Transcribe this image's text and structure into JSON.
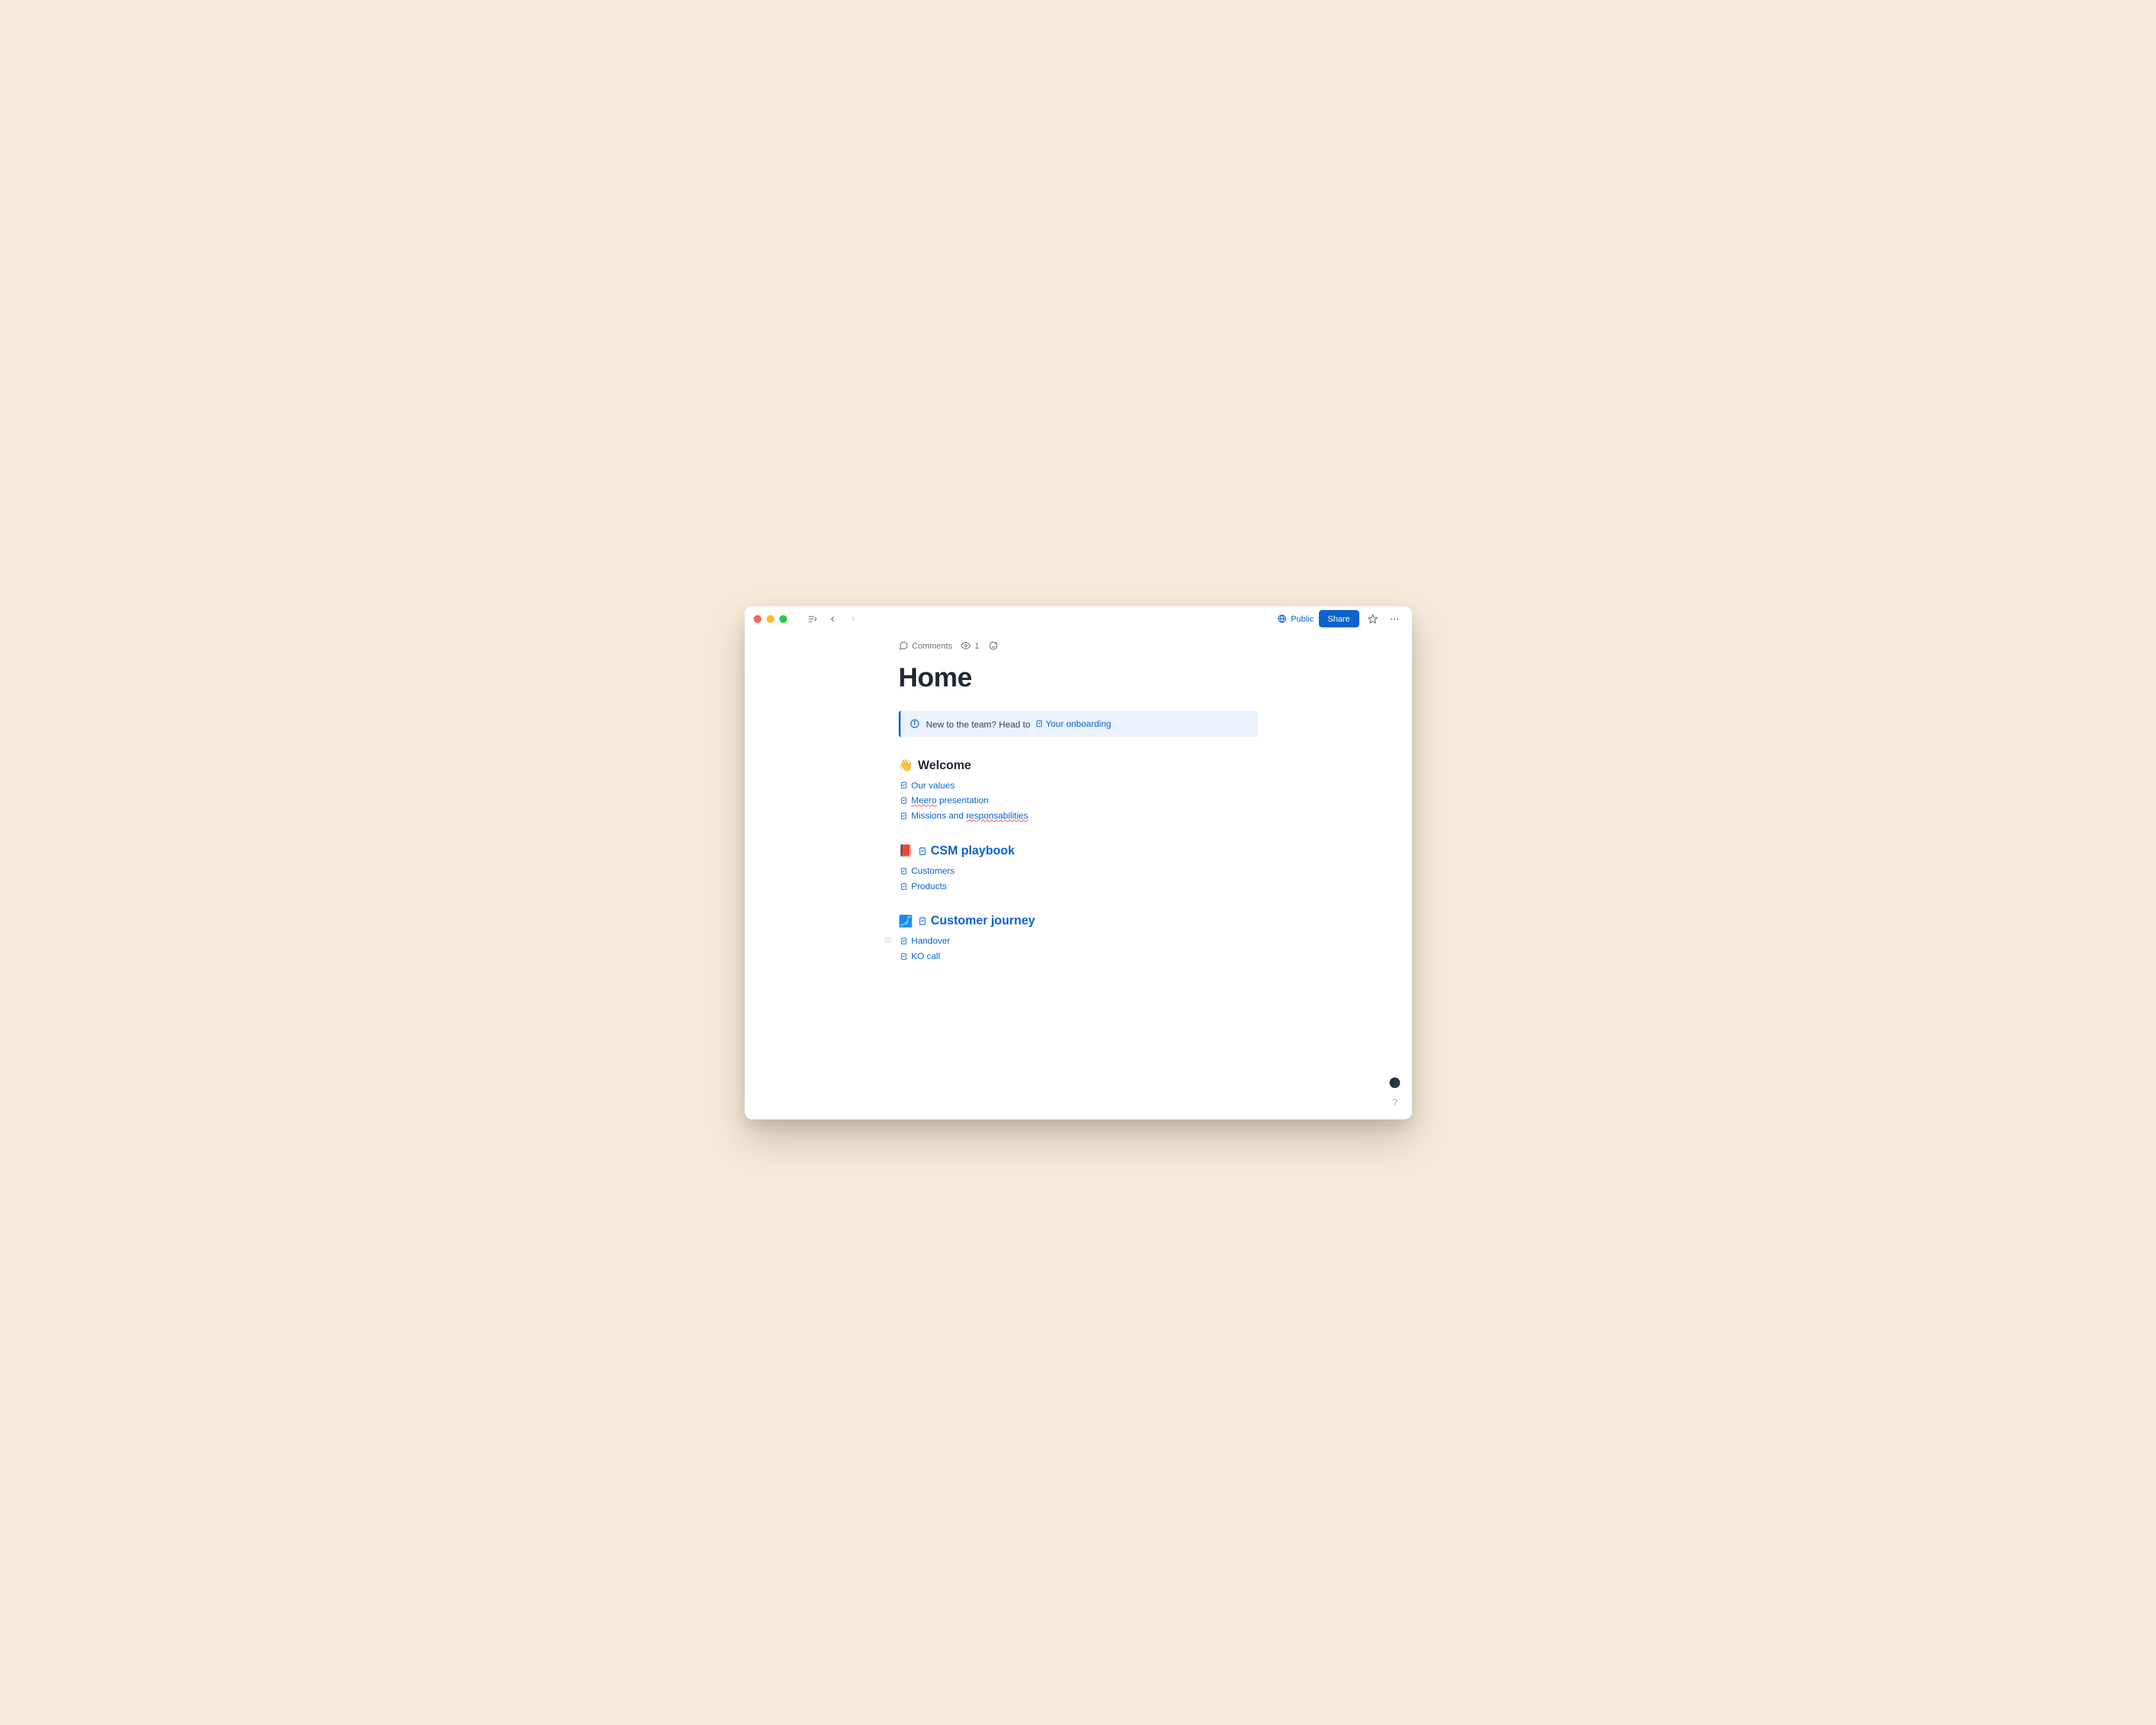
{
  "toolbar": {
    "public_label": "Public",
    "share_label": "Share"
  },
  "meta": {
    "comments_label": "Comments",
    "view_count": "1"
  },
  "page": {
    "title": "Home"
  },
  "callout": {
    "text": "New to the team? Head to",
    "link_label": "Your onboarding"
  },
  "sections": {
    "welcome": {
      "emoji": "👋",
      "heading": "Welcome",
      "links": {
        "values": "Our values",
        "meero_pre": "Meero",
        "meero_post": " presentation",
        "missions_pre": "Missions and ",
        "missions_word": "responsabilities"
      }
    },
    "playbook": {
      "emoji": "📕",
      "heading": "CSM playbook",
      "links": {
        "customers": "Customers",
        "products": "Products"
      }
    },
    "journey": {
      "emoji": "🗾",
      "heading": "Customer journey",
      "links": {
        "handover": "Handover",
        "ko_call": "KO call"
      }
    }
  },
  "floating": {
    "status_emoji": "🌑",
    "help_label": "?"
  }
}
